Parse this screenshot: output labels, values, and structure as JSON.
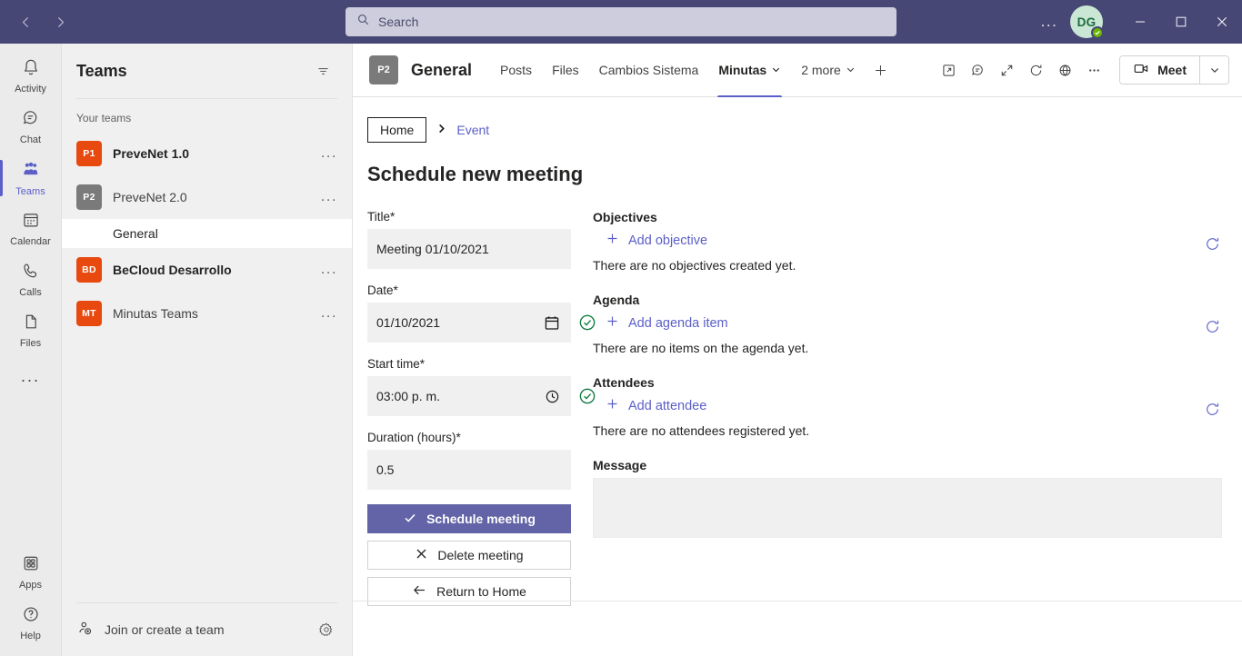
{
  "titlebar": {
    "back_label": "Back",
    "forward_label": "Forward",
    "ellipsis_label": "...",
    "avatar_initials": "DG",
    "presence": "Available",
    "minimize_label": "Minimize",
    "maximize_label": "Maximize",
    "close_label": "Close"
  },
  "search": {
    "placeholder": "Search",
    "value": ""
  },
  "rail": {
    "items": [
      {
        "label": "Activity",
        "icon": "bell-icon",
        "active": false
      },
      {
        "label": "Chat",
        "icon": "chat-icon",
        "active": false
      },
      {
        "label": "Teams",
        "icon": "teams-icon",
        "active": true
      },
      {
        "label": "Calendar",
        "icon": "calendar-icon",
        "active": false
      },
      {
        "label": "Calls",
        "icon": "phone-icon",
        "active": false
      },
      {
        "label": "Files",
        "icon": "file-icon",
        "active": false
      }
    ],
    "overflow_label": "...",
    "bottom_items": [
      {
        "label": "Apps",
        "icon": "apps-icon"
      },
      {
        "label": "Help",
        "icon": "help-icon"
      }
    ]
  },
  "teams_panel": {
    "title": "Teams",
    "filter_icon": "filter-icon",
    "section_label": "Your teams",
    "teams": [
      {
        "initials": "P1",
        "name": "PreveNet 1.0",
        "color": "#e8490f",
        "bold": true,
        "overflow": "..."
      },
      {
        "initials": "P2",
        "name": "PreveNet 2.0",
        "color": "#7a7a7a",
        "bold": false,
        "overflow": "...",
        "channels": [
          {
            "name": "General",
            "selected": true
          }
        ]
      },
      {
        "initials": "BD",
        "name": "BeCloud Desarrollo",
        "color": "#e8490f",
        "bold": true,
        "overflow": "..."
      },
      {
        "initials": "MT",
        "name": "Minutas Teams",
        "color": "#e8490f",
        "bold": false,
        "overflow": "..."
      }
    ],
    "footer": {
      "join_label": "Join or create a team",
      "join_icon": "add-person-icon",
      "settings_icon": "gear-icon"
    }
  },
  "channel_header": {
    "badge": "P2",
    "title": "General",
    "tabs": [
      {
        "label": "Posts",
        "active": false,
        "caret": false
      },
      {
        "label": "Files",
        "active": false,
        "caret": false
      },
      {
        "label": "Cambios Sistema",
        "active": false,
        "caret": false
      },
      {
        "label": "Minutas",
        "active": true,
        "caret": true
      },
      {
        "label": "2 more",
        "active": false,
        "caret": true
      }
    ],
    "add_tab_icon": "plus-icon",
    "icons": [
      "open-in-new-icon",
      "conversation-icon",
      "expand-icon",
      "refresh-icon",
      "globe-icon",
      "more-icon"
    ],
    "meet_label": "Meet",
    "meet_icon": "video-camera-icon",
    "meet_caret_icon": "chevron-down-icon"
  },
  "breadcrumb": {
    "home_label": "Home",
    "separator": "›",
    "current_label": "Event"
  },
  "page": {
    "title": "Schedule new meeting"
  },
  "form": {
    "title_field": {
      "label": "Title*",
      "value": "Meeting  01/10/2021",
      "placeholder": ""
    },
    "date_field": {
      "label": "Date*",
      "value": "01/10/2021",
      "picker_icon": "calendar-picker-icon",
      "valid_icon": "check-circle-icon",
      "valid_color": "#107c41"
    },
    "start_time_field": {
      "label": "Start time*",
      "value": "03:00 p. m.",
      "picker_icon": "clock-icon",
      "valid_icon": "check-circle-icon",
      "valid_color": "#107c41"
    },
    "duration_field": {
      "label": "Duration (hours)*",
      "value": "0.5",
      "placeholder": ""
    },
    "buttons": [
      {
        "label": "Schedule meeting",
        "icon": "check-icon",
        "style": "primary"
      },
      {
        "label": "Delete meeting",
        "icon": "close-x-icon",
        "style": "secondary"
      },
      {
        "label": "Return to Home",
        "icon": "arrow-left-icon",
        "style": "secondary"
      }
    ]
  },
  "sections": [
    {
      "title": "Objectives",
      "add_label": "Add objective",
      "add_icon": "plus-icon",
      "empty_text": "There are no objectives created yet.",
      "refresh_icon": "refresh-icon"
    },
    {
      "title": "Agenda",
      "add_label": "Add agenda item",
      "add_icon": "plus-icon",
      "empty_text": "There are no items on the agenda yet.",
      "refresh_icon": "refresh-icon"
    },
    {
      "title": "Attendees",
      "add_label": "Add attendee",
      "add_icon": "plus-icon",
      "empty_text": "There are no attendees registered yet.",
      "refresh_icon": "refresh-icon"
    }
  ],
  "message": {
    "title": "Message",
    "value": "",
    "placeholder": ""
  },
  "colors": {
    "titlebar": "#464775",
    "accent": "#6264a7",
    "link": "#5b5fc7",
    "team_orange": "#e8490f",
    "success": "#107c41"
  }
}
